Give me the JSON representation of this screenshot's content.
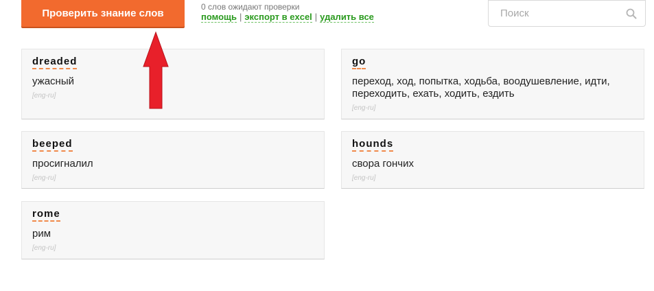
{
  "toolbar": {
    "check_button_label": "Проверить знание слов",
    "status_text": "0 слов ожидают проверки",
    "help_link": "помощь",
    "export_link": "экспорт в excel",
    "delete_link": "удалить все",
    "separator": "|"
  },
  "search": {
    "placeholder": "Поиск",
    "value": ""
  },
  "cards": [
    {
      "word": "dreaded",
      "translation": "ужасный",
      "lang": "[eng-ru]"
    },
    {
      "word": "go",
      "translation": "переход, ход, попытка, ходьба, воодушевление, идти, переходить, ехать, ходить, ездить",
      "lang": "[eng-ru]"
    },
    {
      "word": "beeped",
      "translation": "просигналил",
      "lang": "[eng-ru]"
    },
    {
      "word": "hounds",
      "translation": "свора гончих",
      "lang": "[eng-ru]"
    },
    {
      "word": "rome",
      "translation": "рим",
      "lang": "[eng-ru]"
    }
  ],
  "colors": {
    "accent_orange": "#f26a2e",
    "link_green": "#2a9a1e",
    "arrow_red": "#e8202a"
  },
  "icons": {
    "search": "search-icon",
    "annotation": "red-arrow-up-icon"
  }
}
